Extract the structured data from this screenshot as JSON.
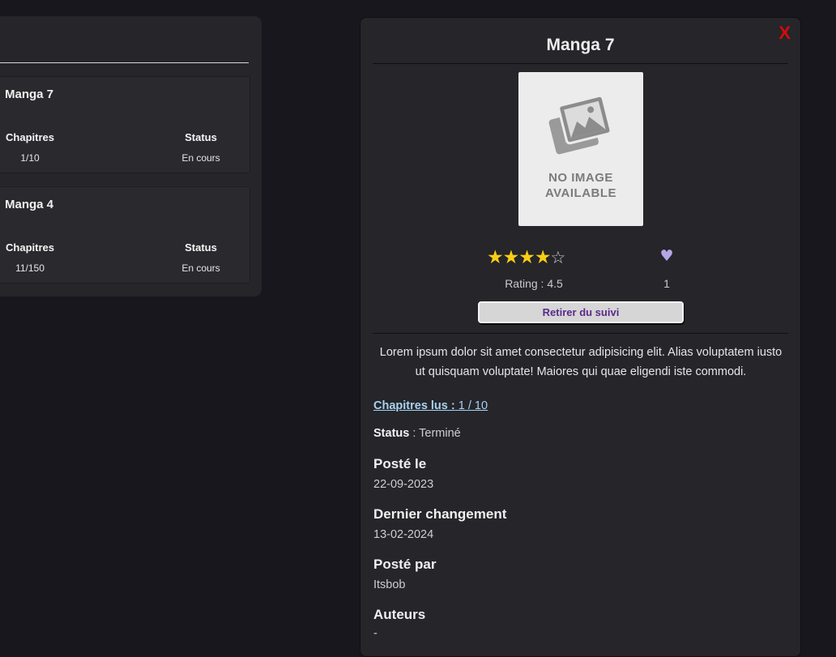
{
  "list": {
    "cards": [
      {
        "title": "Manga 7",
        "chapters_label": "Chapitres",
        "chapters_value": "1/10",
        "status_label": "Status",
        "status_value": "En cours"
      },
      {
        "title": "Manga 4",
        "chapters_label": "Chapitres",
        "chapters_value": "11/150",
        "status_label": "Status",
        "status_value": "En cours"
      }
    ]
  },
  "detail": {
    "close_label": "X",
    "title": "Manga 7",
    "cover_placeholder_line1": "NO IMAGE",
    "cover_placeholder_line2": "AVAILABLE",
    "stars_filled": 4,
    "stars_total": 5,
    "rating_text": "Rating : 4.5",
    "likes": "1",
    "unfollow_label": "Retirer du suivi",
    "description": "Lorem ipsum dolor sit amet consectetur adipisicing elit. Alias voluptatem iusto ut quisquam voluptate! Maiores qui quae eligendi iste commodi.",
    "chapters_read_label": "Chapitres lus :",
    "chapters_read_value": "1 / 10",
    "status_label": "Status",
    "status_value": "Terminé",
    "posted_label": "Posté le",
    "posted_value": "22-09-2023",
    "changed_label": "Dernier changement",
    "changed_value": "13-02-2024",
    "posted_by_label": "Posté par",
    "posted_by_value": "Itsbob",
    "authors_label": "Auteurs",
    "authors_value": "-"
  },
  "colors": {
    "background": "#18171d",
    "panel": "#25252a",
    "close": "#d40b0b",
    "star": "#f8ce14",
    "heart": "#b5a6e6",
    "link": "#a8d2f2",
    "button_text": "#5a2a8a"
  },
  "icons": {
    "heart": "heart-icon",
    "star": "star-icon",
    "cover": "image-placeholder-icon",
    "close": "close-icon"
  }
}
